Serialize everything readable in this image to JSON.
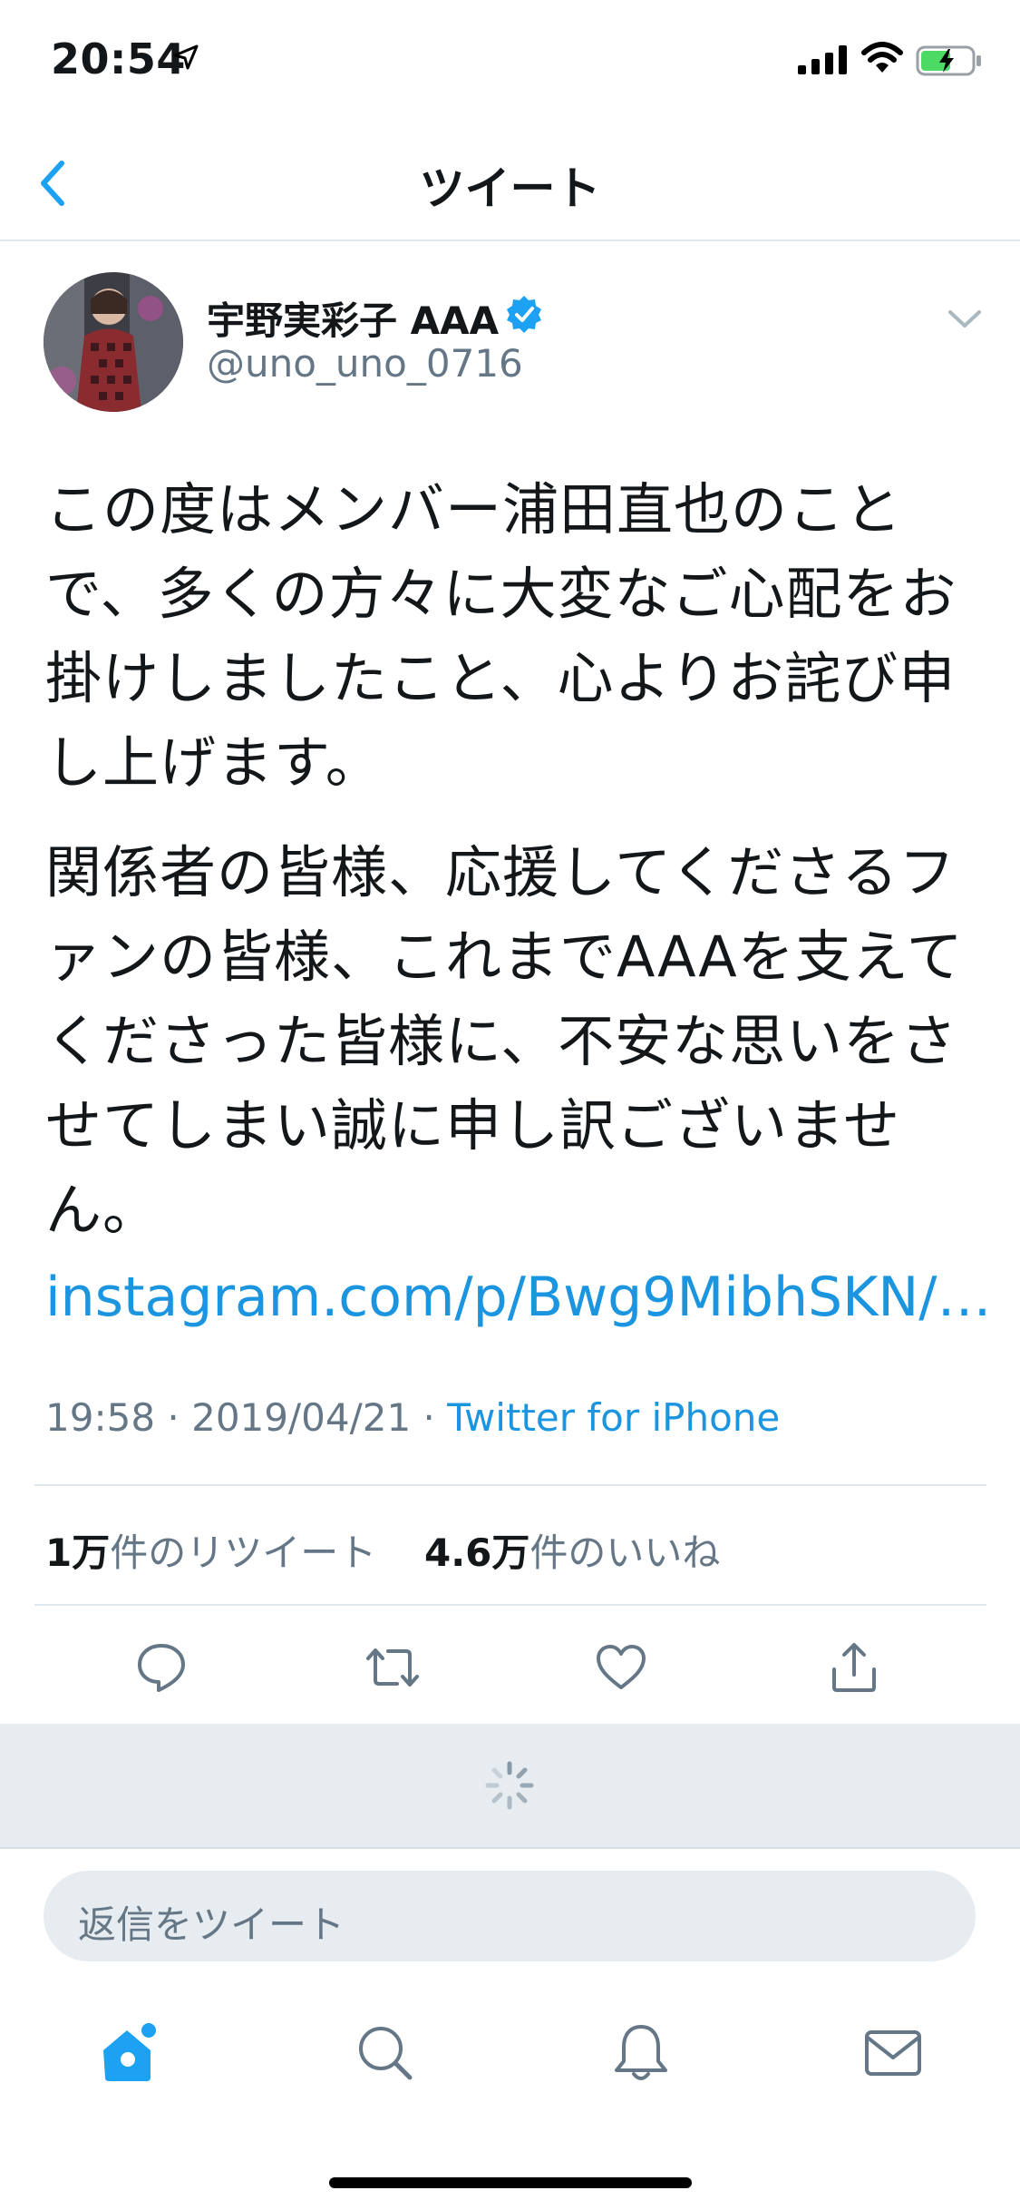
{
  "status_bar": {
    "time": "20:54"
  },
  "nav": {
    "title": "ツイート"
  },
  "tweet": {
    "author_name": "宇野実彩子 AAA",
    "author_handle": "@uno_uno_0716",
    "paragraph_1": "この度はメンバー浦田直也のことで、多くの方々に大変なご心配をお掛けしましたこと、心よりお詫び申し上げます。",
    "paragraph_2": "関係者の皆様、応援してくださるファンの皆様、これまでAAAを支えてくださった皆様に、不安な思いをさせてしまい誠に申し訳ございません。",
    "link": "instagram.com/p/Bwg9MibhSKN/…",
    "time": "19:58",
    "date": "2019/04/21",
    "source": "Twitter for iPhone",
    "retweets_count": "1万",
    "retweets_label": "件のリツイート",
    "likes_count": "4.6万",
    "likes_label": "件のいいね"
  },
  "reply": {
    "placeholder": "返信をツイート"
  },
  "icons": {
    "back": "chevron-left-icon",
    "verified": "verified-badge-icon",
    "more": "chevron-down-icon",
    "reply": "reply-icon",
    "retweet": "retweet-icon",
    "like": "heart-icon",
    "share": "share-icon",
    "home": "home-icon",
    "search": "search-icon",
    "notifications": "bell-icon",
    "messages": "envelope-icon"
  },
  "colors": {
    "accent": "#1da1f2",
    "link": "#1b95e0",
    "muted_text": "#657786",
    "divider": "#e1e8ed",
    "loading_bg": "#e6ecf0"
  }
}
